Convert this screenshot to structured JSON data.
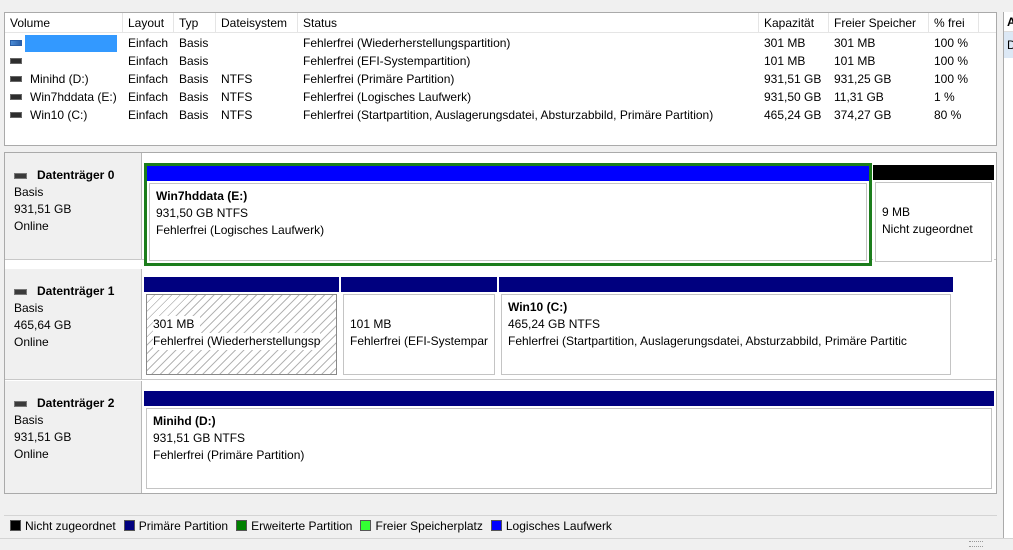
{
  "volume_list": {
    "columns": [
      "Volume",
      "Layout",
      "Typ",
      "Dateisystem",
      "Status",
      "Kapazität",
      "Freier Speicher",
      "% frei"
    ],
    "rows": [
      {
        "volume": "",
        "layout": "Einfach",
        "typ": "Basis",
        "fs": "",
        "status": "Fehlerfrei (Wiederherstellungspartition)",
        "kapazitaet": "301 MB",
        "frei": "301 MB",
        "prozent": "100 %",
        "selected": true
      },
      {
        "volume": "",
        "layout": "Einfach",
        "typ": "Basis",
        "fs": "",
        "status": "Fehlerfrei (EFI-Systempartition)",
        "kapazitaet": "101 MB",
        "frei": "101 MB",
        "prozent": "100 %"
      },
      {
        "volume": "Minihd (D:)",
        "layout": "Einfach",
        "typ": "Basis",
        "fs": "NTFS",
        "status": "Fehlerfrei (Primäre Partition)",
        "kapazitaet": "931,51 GB",
        "frei": "931,25 GB",
        "prozent": "100 %"
      },
      {
        "volume": "Win7hddata (E:)",
        "layout": "Einfach",
        "typ": "Basis",
        "fs": "NTFS",
        "status": "Fehlerfrei (Logisches Laufwerk)",
        "kapazitaet": "931,50 GB",
        "frei": "11,31 GB",
        "prozent": "1 %"
      },
      {
        "volume": "Win10 (C:)",
        "layout": "Einfach",
        "typ": "Basis",
        "fs": "NTFS",
        "status": "Fehlerfrei (Startpartition, Auslagerungsdatei, Absturzabbild, Primäre Partition)",
        "kapazitaet": "465,24 GB",
        "frei": "374,27 GB",
        "prozent": "80 %"
      }
    ]
  },
  "disks": [
    {
      "title": "Datenträger 0",
      "type": "Basis",
      "size": "931,51 GB",
      "state": "Online",
      "partitions": [
        {
          "name": "Win7hddata  (E:)",
          "size": "931,50 GB NTFS",
          "status": "Fehlerfrei (Logisches Laufwerk)"
        },
        {
          "name": "",
          "size": "9 MB",
          "status": "Nicht zugeordnet"
        }
      ]
    },
    {
      "title": "Datenträger 1",
      "type": "Basis",
      "size": "465,64 GB",
      "state": "Online",
      "partitions": [
        {
          "name": "",
          "size": "301 MB",
          "status": "Fehlerfrei (Wiederherstellungsp"
        },
        {
          "name": "",
          "size": "101 MB",
          "status": "Fehlerfrei (EFI-Systempar"
        },
        {
          "name": "Win10  (C:)",
          "size": "465,24 GB NTFS",
          "status": "Fehlerfrei (Startpartition, Auslagerungsdatei, Absturzabbild, Primäre Partitic"
        }
      ]
    },
    {
      "title": "Datenträger 2",
      "type": "Basis",
      "size": "931,51 GB",
      "state": "Online",
      "partitions": [
        {
          "name": "Minihd  (D:)",
          "size": "931,51 GB NTFS",
          "status": "Fehlerfrei (Primäre Partition)"
        }
      ]
    }
  ],
  "legend": [
    {
      "label": "Nicht zugeordnet",
      "color": "#000000"
    },
    {
      "label": "Primäre Partition",
      "color": "#00007f"
    },
    {
      "label": "Erweiterte Partition",
      "color": "#008000"
    },
    {
      "label": "Freier Speicherplatz",
      "color": "#33ff33"
    },
    {
      "label": "Logisches Laufwerk",
      "color": "#0000ff"
    }
  ],
  "colors": {
    "unallocated": "#000000",
    "primary": "#00007f",
    "extended": "#1c7d1c",
    "logical": "#0000ff",
    "selection": "#3399ff"
  },
  "action_pane": {
    "header": "A",
    "item": "D"
  }
}
